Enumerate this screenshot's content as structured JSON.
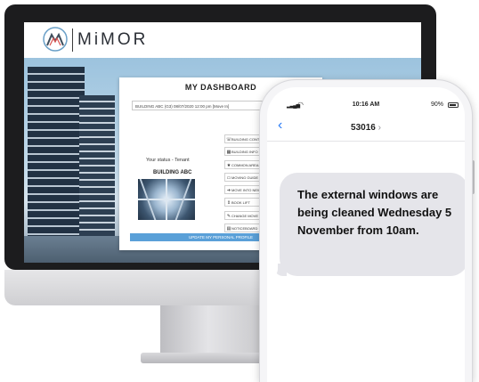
{
  "brand": {
    "name": "MiMOR"
  },
  "dashboard": {
    "title": "MY DASHBOARD",
    "unit_select_value": "BUILDING ABC (G3) 08/07/2020 12:00 pm [Move In]",
    "status_text": "Your status - Tenant",
    "building_name": "BUILDING ABC",
    "menu": [
      {
        "icon": "phone-icon",
        "glyph": "☏",
        "label": "BUILDING CONTACTS"
      },
      {
        "icon": "building-icon",
        "glyph": "▦",
        "label": "BUILDING INFO"
      },
      {
        "icon": "star-icon",
        "glyph": "★",
        "label": "COMMON AREAS"
      },
      {
        "icon": "book-icon",
        "glyph": "▭",
        "label": "MOVING GUIDE"
      },
      {
        "icon": "arrow-icon",
        "glyph": "➔",
        "label": "MOVE INTO NEW"
      },
      {
        "icon": "lift-icon",
        "glyph": "⇕",
        "label": "BOOK LIFT"
      },
      {
        "icon": "edit-icon",
        "glyph": "✎",
        "label": "CHANGE MOVE"
      },
      {
        "icon": "noticeboard-icon",
        "glyph": "▤",
        "label": "NOTICEBOARD"
      }
    ],
    "update_button": "UPDATE MY PERSONAL PROFILE"
  },
  "phone": {
    "status_bar": {
      "time": "10:16 AM",
      "battery": "90%",
      "battery_level": 0.9
    },
    "contact": "53016",
    "contact_chevron": "›",
    "back_glyph": "‹",
    "message": "The external windows are being cleaned Wednesday 5 November from 10am."
  }
}
